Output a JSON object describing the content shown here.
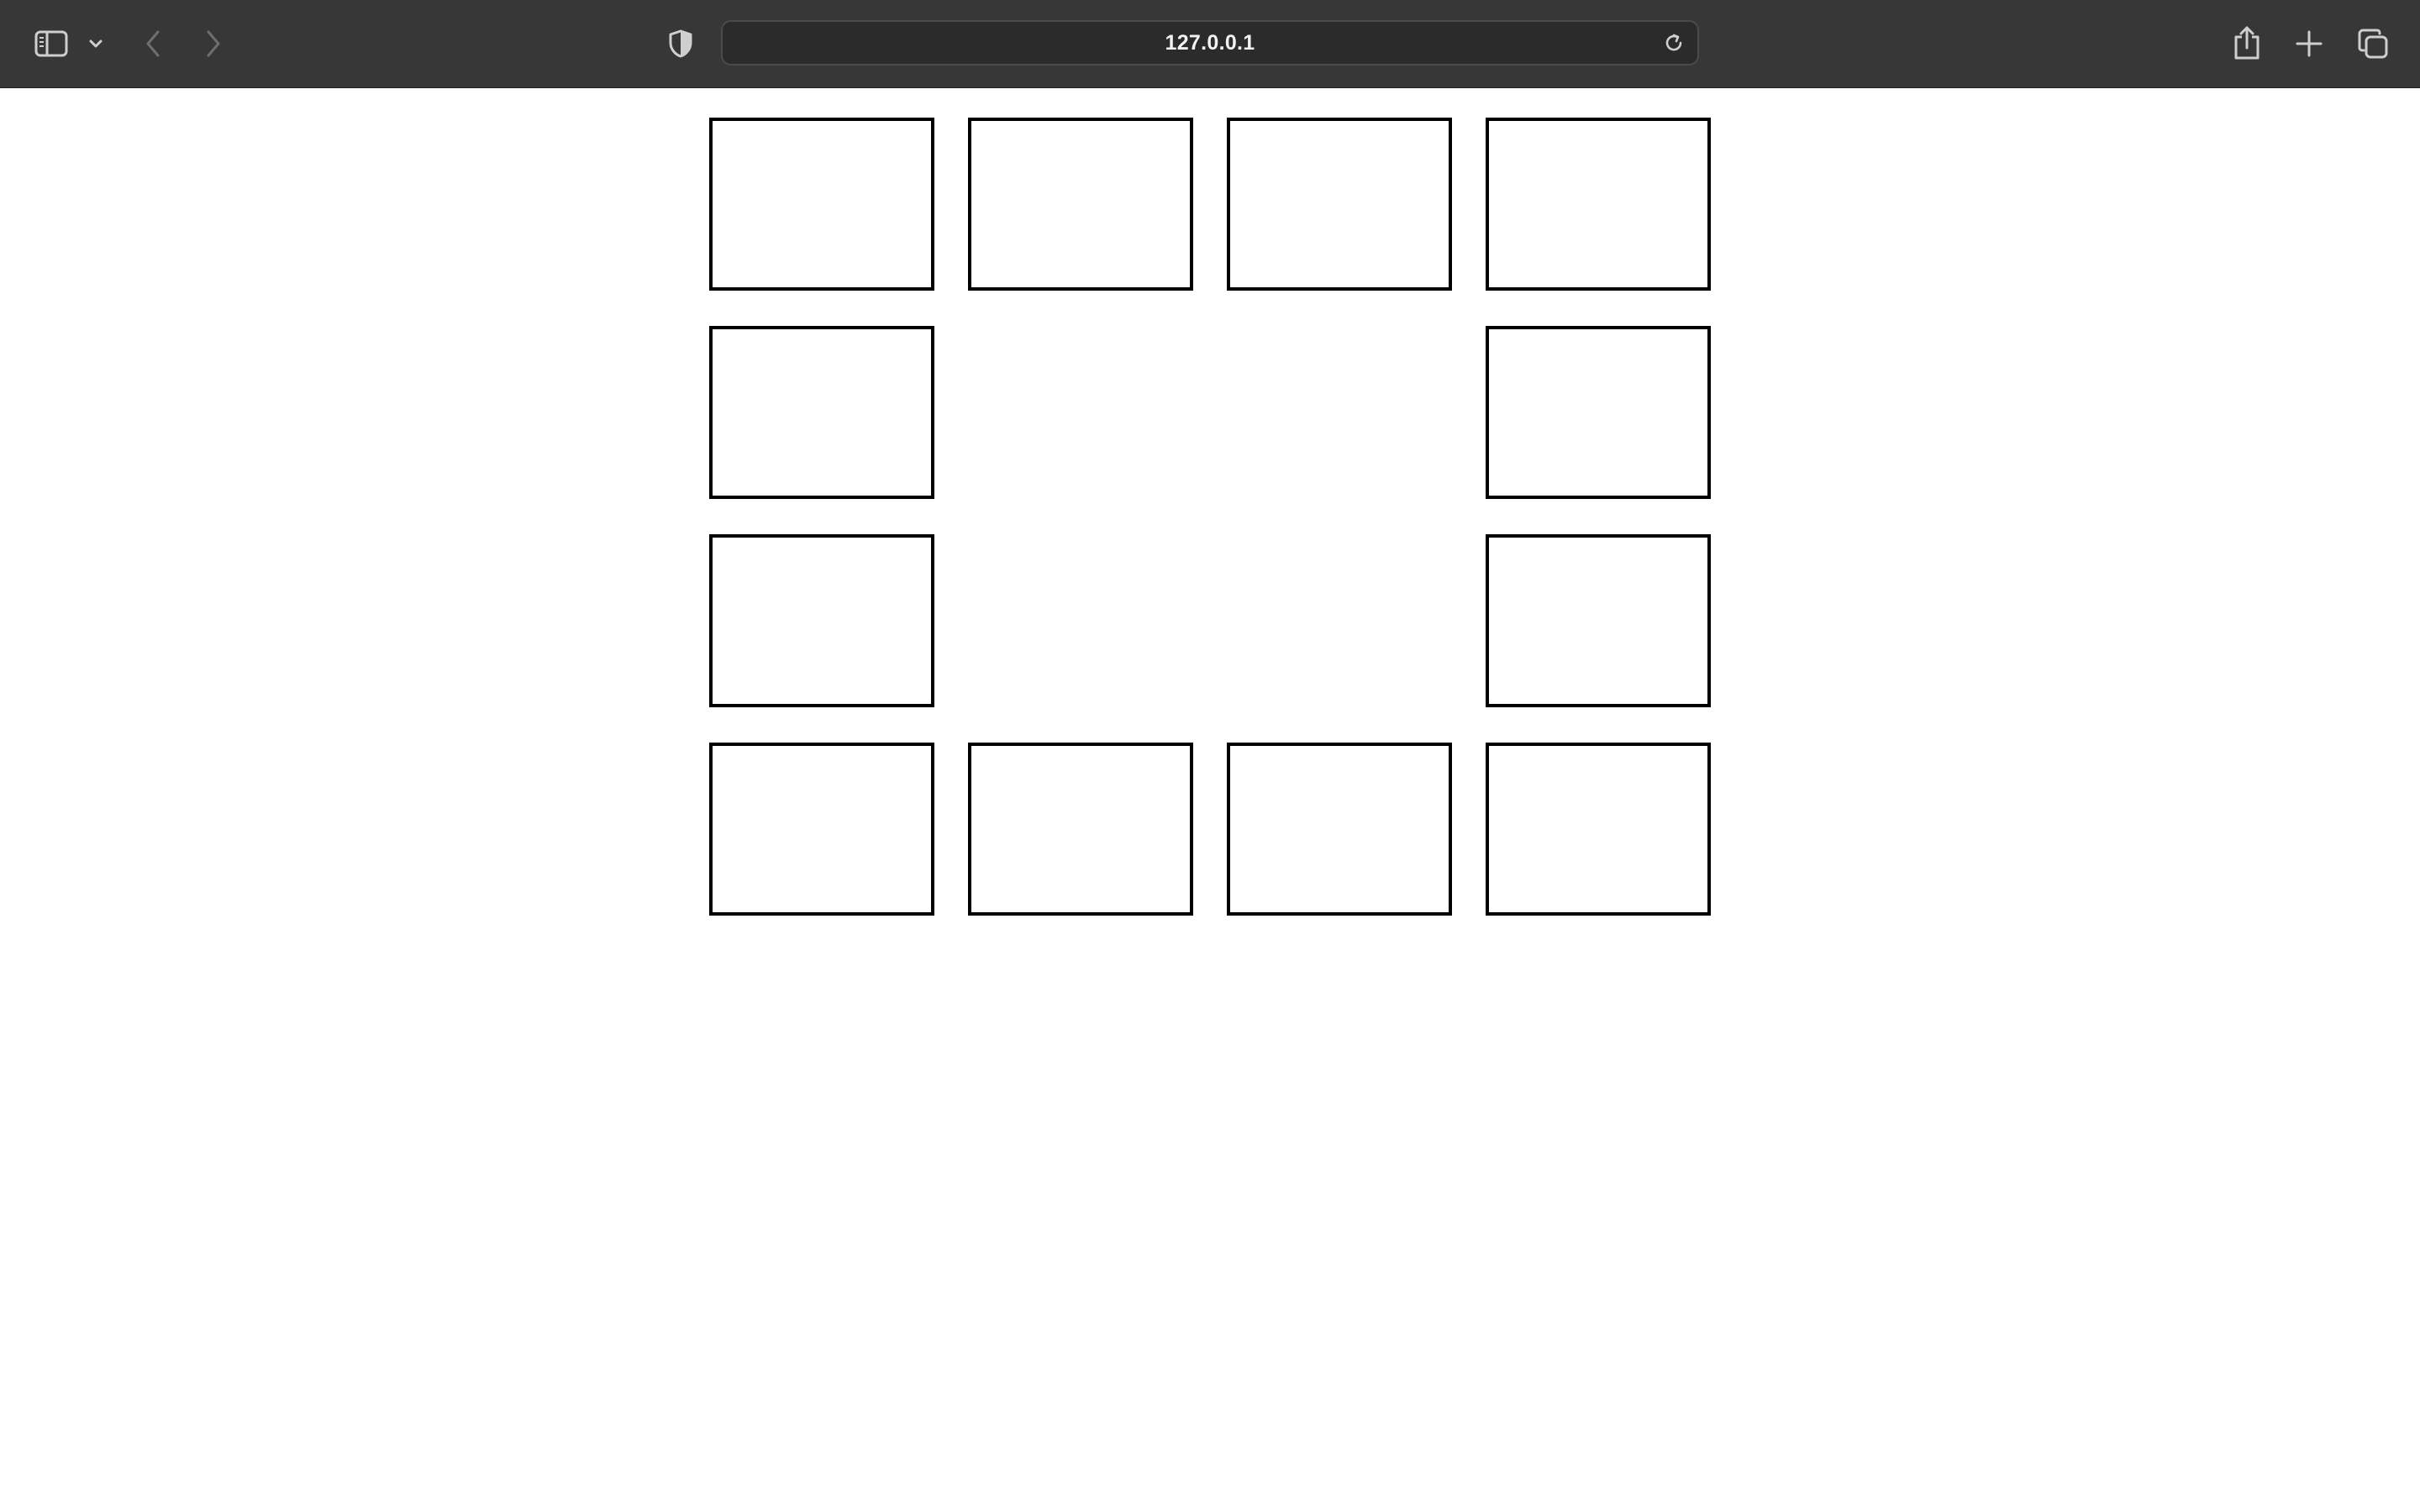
{
  "browser": {
    "address_text": "127.0.0.1",
    "icons": {
      "sidebar": "sidebar-icon",
      "sidebar_menu": "chevron-down-icon",
      "back": "chevron-left-icon",
      "forward": "chevron-right-icon",
      "privacy": "shield-icon",
      "reload": "reload-icon",
      "share": "share-icon",
      "new_tab": "plus-icon",
      "tab_overview": "tabs-overview-icon"
    },
    "colors": {
      "toolbar": "#373737",
      "address_bar": "#2b2b2b",
      "icon": "#cfcfcf",
      "icon_disabled": "#6e6e6e"
    }
  },
  "board": {
    "rows": [
      [
        true,
        true,
        true,
        true
      ],
      [
        true,
        false,
        false,
        true
      ],
      [
        true,
        false,
        false,
        true
      ],
      [
        true,
        true,
        true,
        true
      ]
    ],
    "cell_border_color": "#000000"
  }
}
